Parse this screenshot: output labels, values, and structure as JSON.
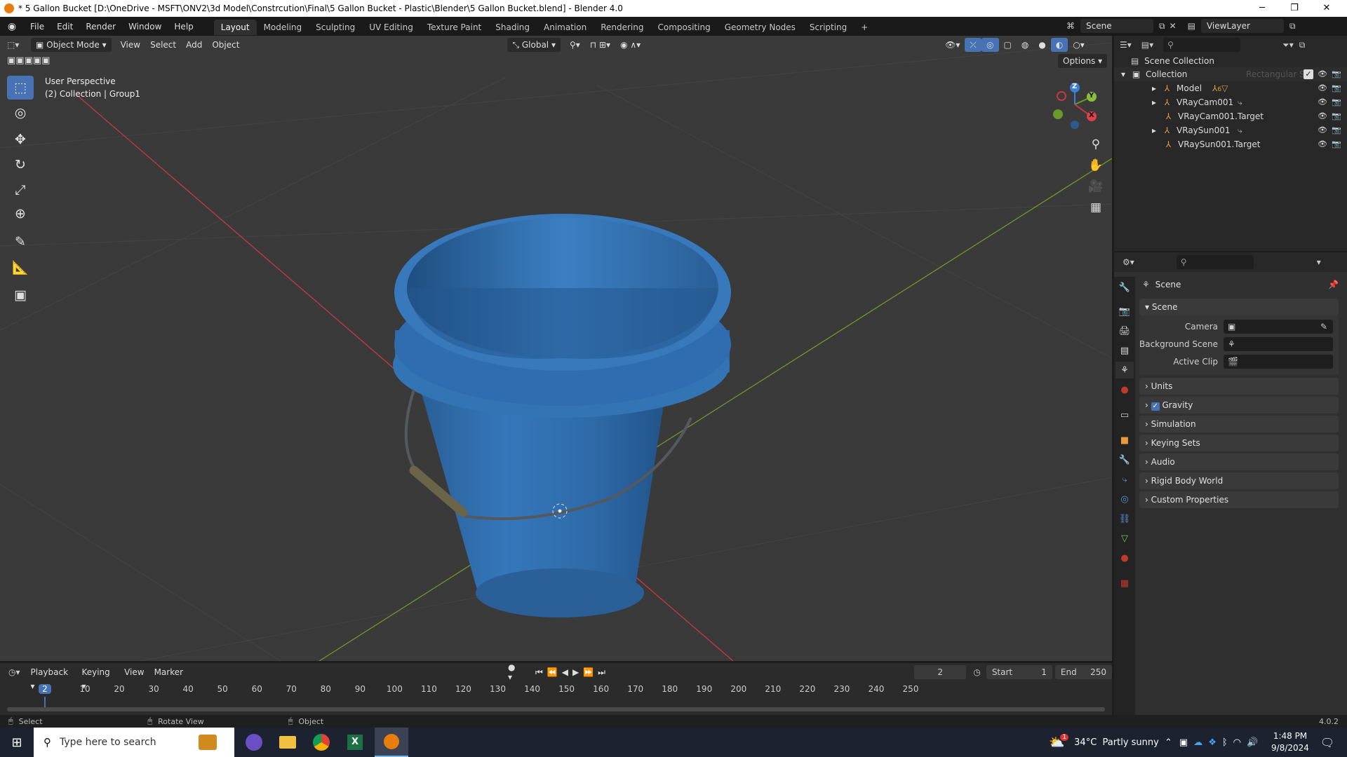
{
  "window": {
    "title": "* 5 Gallon Bucket [D:\\OneDrive - MSFT\\ONV2\\3d Model\\Constrcution\\Final\\5 Gallon Bucket - Plastic\\Blender\\5 Gallon Bucket.blend] - Blender 4.0"
  },
  "menu": [
    "File",
    "Edit",
    "Render",
    "Window",
    "Help"
  ],
  "workspaces": [
    "Layout",
    "Modeling",
    "Sculpting",
    "UV Editing",
    "Texture Paint",
    "Shading",
    "Animation",
    "Rendering",
    "Compositing",
    "Geometry Nodes",
    "Scripting"
  ],
  "scene": {
    "name": "Scene",
    "view_layer": "ViewLayer"
  },
  "viewport": {
    "mode": "Object Mode",
    "menus": [
      "View",
      "Select",
      "Add",
      "Object"
    ],
    "orientation": "Global",
    "options": "Options",
    "info_line1": "User Perspective",
    "info_line2": "(2) Collection | Group1"
  },
  "gizmo": {
    "x": "X",
    "y": "Y",
    "z": "Z"
  },
  "outliner": {
    "root": "Scene Collection",
    "collection": "Collection",
    "items": [
      {
        "label": "Model",
        "expand": "▸"
      },
      {
        "label": "VRayCam001",
        "expand": "▸"
      },
      {
        "label": "VRayCam001.Target",
        "expand": ""
      },
      {
        "label": "VRaySun001",
        "expand": "▸"
      },
      {
        "label": "VRaySun001.Target",
        "expand": ""
      }
    ],
    "ghost_label": "Rectangular S",
    "model_badge": "6"
  },
  "properties": {
    "header": "Scene",
    "panel": "Scene",
    "fields": [
      {
        "label": "Camera"
      },
      {
        "label": "Background Scene"
      },
      {
        "label": "Active Clip"
      }
    ],
    "sections": [
      "Units",
      "Gravity",
      "Simulation",
      "Keying Sets",
      "Audio",
      "Rigid Body World",
      "Custom Properties"
    ]
  },
  "timeline": {
    "menus": [
      "Playback",
      "Keying",
      "View",
      "Marker"
    ],
    "current_frame": "2",
    "start_label": "Start",
    "start": "1",
    "end_label": "End",
    "end": "250",
    "ticks": [
      "2",
      "10",
      "20",
      "30",
      "40",
      "50",
      "60",
      "70",
      "80",
      "90",
      "100",
      "110",
      "120",
      "130",
      "140",
      "150",
      "160",
      "170",
      "180",
      "190",
      "200",
      "210",
      "220",
      "230",
      "240",
      "250"
    ]
  },
  "status": {
    "select": "Select",
    "rotate": "Rotate View",
    "object": "Object",
    "version": "4.0.2"
  },
  "taskbar": {
    "search": "Type here to search",
    "weather": "34°C  Partly sunny",
    "time": "1:48 PM",
    "date": "9/8/2024",
    "weather_badge": "1"
  },
  "colors": {
    "accent": "#4772b3",
    "bucket": "#2f6fae",
    "bg": "#3a3a3a",
    "x_axis": "#c8383e",
    "y_axis": "#6c9a2a"
  }
}
